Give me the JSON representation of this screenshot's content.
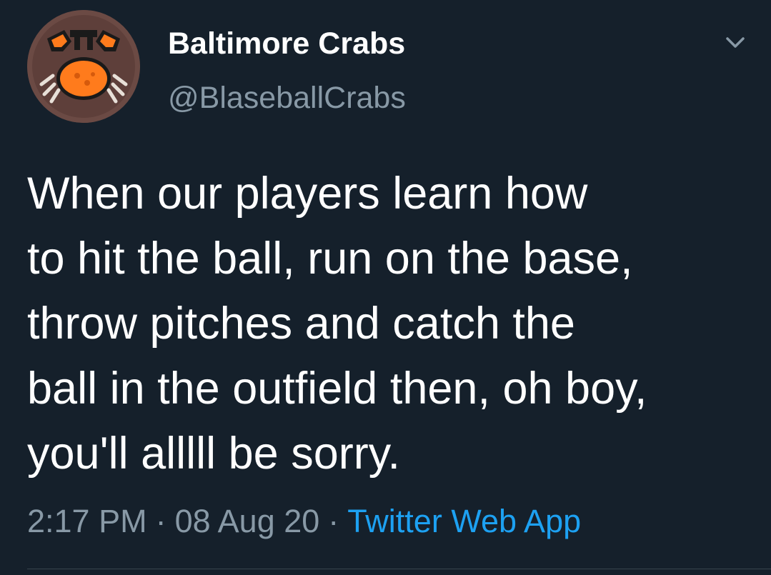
{
  "tweet": {
    "author": {
      "display_name": "Baltimore Crabs",
      "handle": "@BlaseballCrabs",
      "avatar_icon": "crab-icon"
    },
    "text": "When our players learn how\nto hit the ball, run on the base,\nthrow pitches and catch the\nball in the outfield then, oh boy,\nyou'll alllll be sorry.",
    "time": "2:17 PM",
    "date": "08 Aug 20",
    "separator": "·",
    "source": "Twitter Web App",
    "menu_icon": "chevron-down-icon"
  },
  "colors": {
    "background": "#15202b",
    "text_primary": "#ffffff",
    "text_secondary": "#8899a6",
    "link": "#1da1f2",
    "divider": "#38444d",
    "crab_orange": "#ff7b1c"
  }
}
